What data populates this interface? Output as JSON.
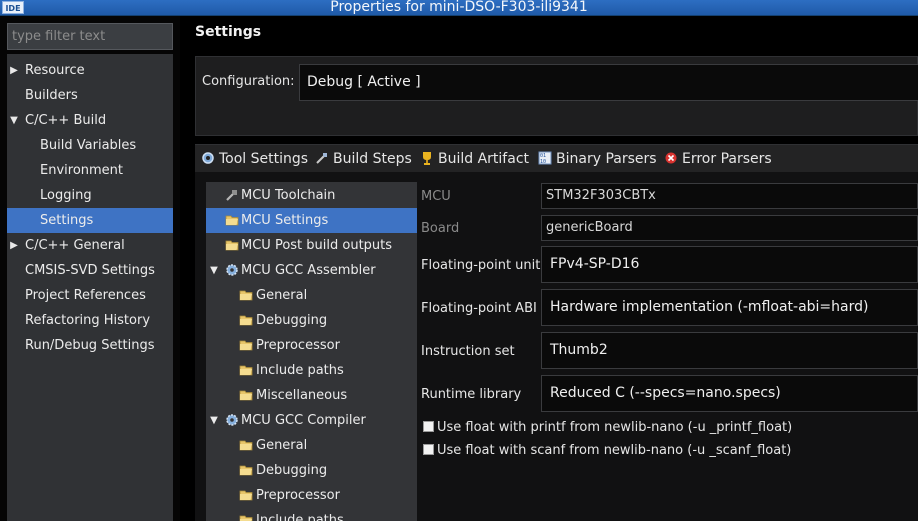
{
  "window": {
    "app_icon": "IDE",
    "title": "Properties for mini-DSO-F303-ili9341"
  },
  "sidebar": {
    "filter_placeholder": "type filter text",
    "items": [
      {
        "label": "Resource",
        "expander": "collapsed"
      },
      {
        "label": "Builders"
      },
      {
        "label": "C/C++ Build",
        "expander": "expanded"
      },
      {
        "label": "Build Variables"
      },
      {
        "label": "Environment"
      },
      {
        "label": "Logging"
      },
      {
        "label": "Settings",
        "selected": true
      },
      {
        "label": "C/C++ General",
        "expander": "collapsed"
      },
      {
        "label": "CMSIS-SVD Settings"
      },
      {
        "label": "Project References"
      },
      {
        "label": "Refactoring History"
      },
      {
        "label": "Run/Debug Settings"
      }
    ]
  },
  "page": {
    "title": "Settings",
    "configuration_label": "Configuration:",
    "configuration_value": "Debug  [ Active ]"
  },
  "tabs": [
    {
      "label": "Tool Settings",
      "icon": "tool-settings-icon"
    },
    {
      "label": "Build Steps",
      "icon": "build-steps-icon"
    },
    {
      "label": "Build Artifact",
      "icon": "trophy-icon"
    },
    {
      "label": "Binary Parsers",
      "icon": "binary-icon"
    },
    {
      "label": "Error Parsers",
      "icon": "error-icon"
    }
  ],
  "tool_tree": [
    {
      "label": "MCU Toolchain",
      "icon": "toolchain-icon"
    },
    {
      "label": "MCU Settings",
      "icon": "folder-icon",
      "selected": true
    },
    {
      "label": "MCU Post build outputs",
      "icon": "folder-icon"
    },
    {
      "label": "MCU GCC Assembler",
      "icon": "gear-icon",
      "expander": "expanded"
    },
    {
      "label": "General",
      "icon": "folder-icon"
    },
    {
      "label": "Debugging",
      "icon": "folder-icon"
    },
    {
      "label": "Preprocessor",
      "icon": "folder-icon"
    },
    {
      "label": "Include paths",
      "icon": "folder-icon"
    },
    {
      "label": "Miscellaneous",
      "icon": "folder-icon"
    },
    {
      "label": "MCU GCC Compiler",
      "icon": "gear-icon",
      "expander": "expanded"
    },
    {
      "label": "General",
      "icon": "folder-icon"
    },
    {
      "label": "Debugging",
      "icon": "folder-icon"
    },
    {
      "label": "Preprocessor",
      "icon": "folder-icon"
    },
    {
      "label": "Include paths",
      "icon": "folder-icon"
    }
  ],
  "properties": {
    "mcu_label": "MCU",
    "mcu_value": "STM32F303CBTx",
    "board_label": "Board",
    "board_value": "genericBoard",
    "fpu_label": "Floating-point unit",
    "fpu_value": "FPv4-SP-D16",
    "fpabi_label": "Floating-point ABI",
    "fpabi_value": "Hardware implementation (-mfloat-abi=hard)",
    "iset_label": "Instruction set",
    "iset_value": "Thumb2",
    "runtime_label": "Runtime library",
    "runtime_value": "Reduced C (--specs=nano.specs)",
    "printf_float_label": "Use float with printf from newlib-nano (-u _printf_float)",
    "printf_float_checked": false,
    "scanf_float_label": "Use float with scanf from newlib-nano (-u _scanf_float)",
    "scanf_float_checked": false
  }
}
